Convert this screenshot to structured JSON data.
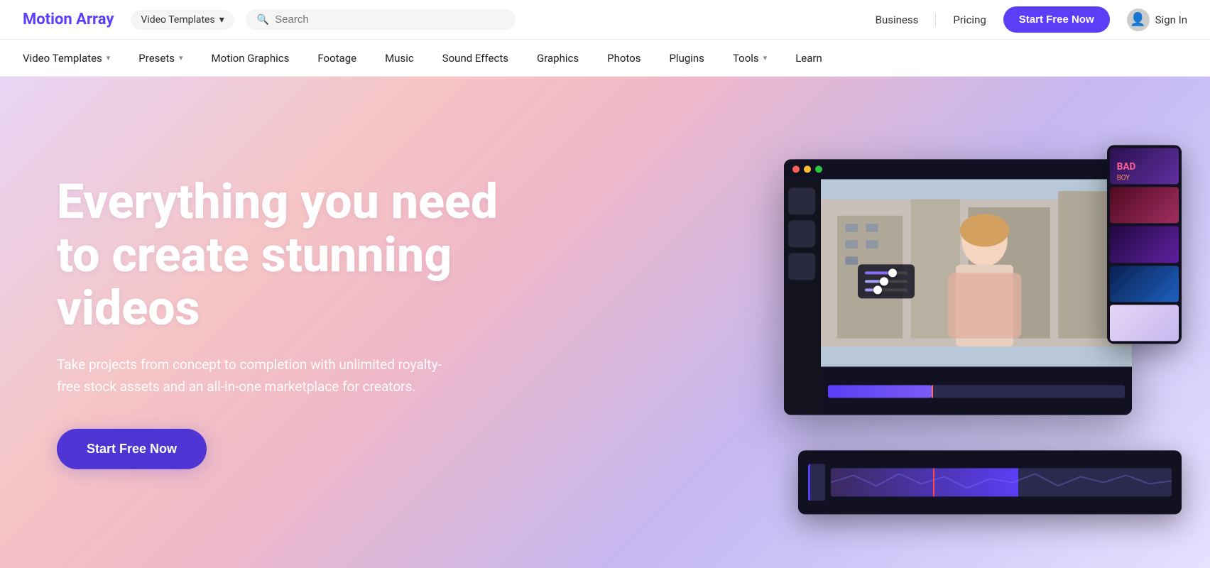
{
  "logo": {
    "text": "Motion Array"
  },
  "topNav": {
    "videoTemplatesDropdown": "Video Templates",
    "searchPlaceholder": "Search",
    "businessLabel": "Business",
    "pricingLabel": "Pricing",
    "startFreeLabel": "Start Free Now",
    "signInLabel": "Sign In"
  },
  "secondaryNav": {
    "items": [
      {
        "label": "Video Templates",
        "hasDropdown": true
      },
      {
        "label": "Presets",
        "hasDropdown": true
      },
      {
        "label": "Motion Graphics",
        "hasDropdown": false
      },
      {
        "label": "Footage",
        "hasDropdown": false
      },
      {
        "label": "Music",
        "hasDropdown": false
      },
      {
        "label": "Sound Effects",
        "hasDropdown": false
      },
      {
        "label": "Graphics",
        "hasDropdown": false
      },
      {
        "label": "Photos",
        "hasDropdown": false
      },
      {
        "label": "Plugins",
        "hasDropdown": false
      },
      {
        "label": "Tools",
        "hasDropdown": true
      },
      {
        "label": "Learn",
        "hasDropdown": false
      }
    ]
  },
  "hero": {
    "heading": "Everything you need to create stunning videos",
    "subtext": "Take projects from concept to completion with unlimited royalty-free stock assets and an all-in-one marketplace for creators.",
    "ctaLabel": "Start Free Now"
  }
}
